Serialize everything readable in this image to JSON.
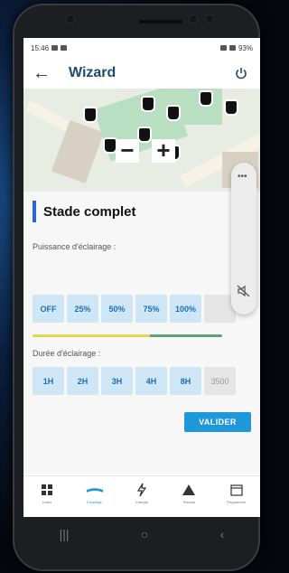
{
  "status_bar": {
    "time": "15:46",
    "battery": "93%"
  },
  "app_bar": {
    "back_icon": "arrow-left-icon",
    "title": "Wizard",
    "power_icon": "power-icon"
  },
  "map": {
    "zoom_out": "−",
    "zoom_in": "+"
  },
  "section": {
    "name": "Stade complet"
  },
  "power": {
    "label": "Puissance d'éclairage :",
    "options": [
      "OFF",
      "25%",
      "50%",
      "75%",
      "100%",
      ""
    ]
  },
  "duration": {
    "label": "Durée d'éclairage :",
    "options": [
      "1H",
      "2H",
      "3H",
      "4H",
      "8H",
      "3500"
    ]
  },
  "actions": {
    "validate": "VALIDER"
  },
  "volume_panel": {
    "more": "•••",
    "mute_icon": "speaker-mute-icon"
  },
  "tabs": [
    {
      "label": "Index",
      "icon": "grid-icon"
    },
    {
      "label": "Eclairage",
      "icon": "lamp-icon",
      "active": true
    },
    {
      "label": "Energie",
      "icon": "bolt-icon"
    },
    {
      "label": "Pannes",
      "icon": "warning-icon"
    },
    {
      "label": "Programme",
      "icon": "calendar-icon"
    }
  ],
  "system_nav": {
    "recents": "|||",
    "home": "○",
    "back": "‹"
  },
  "colors": {
    "accent": "#1f98d9",
    "title": "#1f4c6b",
    "chip_bg": "#cfe6f6",
    "section_bar": "#2e63d6"
  }
}
